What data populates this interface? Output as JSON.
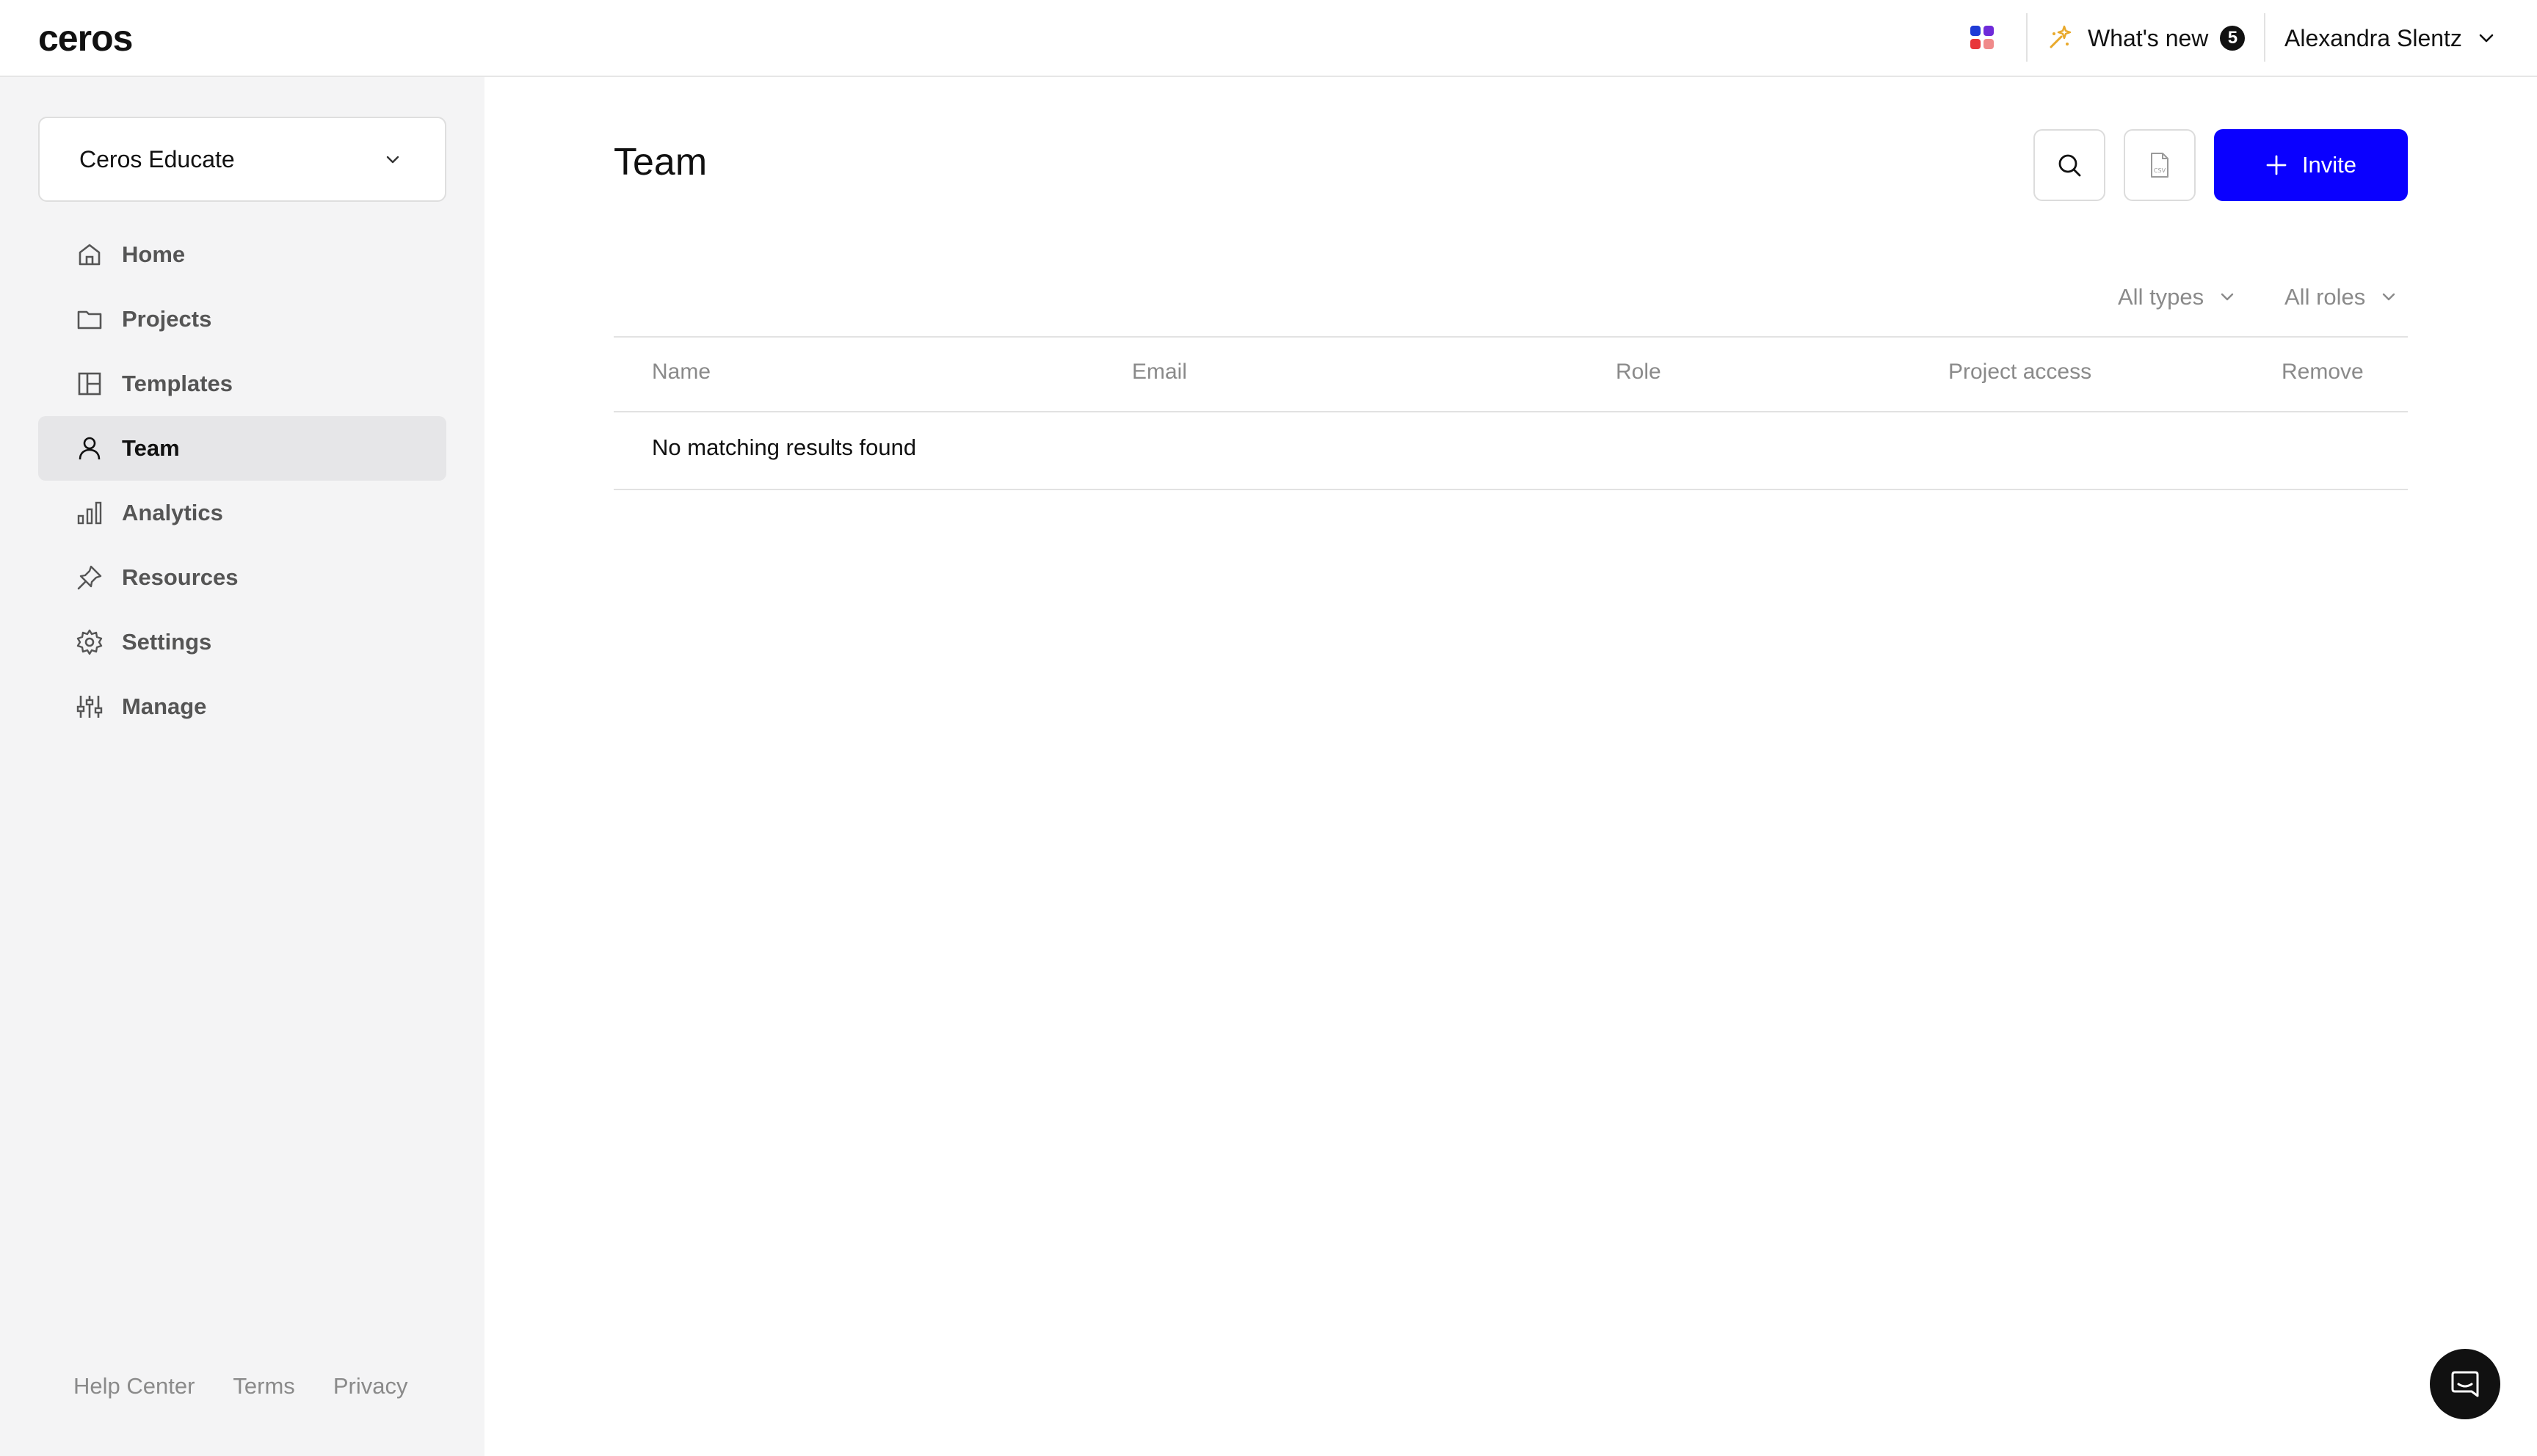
{
  "brand": {
    "logo_text": "ceros"
  },
  "topbar": {
    "apps_icon": "apps-grid-icon",
    "whats_new": {
      "label": "What's new",
      "count": "5",
      "icon": "sparkle-icon"
    },
    "user": {
      "name": "Alexandra Slentz",
      "icon": "chevron-down-icon"
    }
  },
  "sidebar": {
    "workspace": {
      "label": "Ceros Educate",
      "icon": "chevron-down-icon"
    },
    "items": [
      {
        "label": "Home",
        "icon": "home-icon",
        "active": false
      },
      {
        "label": "Projects",
        "icon": "folder-icon",
        "active": false
      },
      {
        "label": "Templates",
        "icon": "templates-icon",
        "active": false
      },
      {
        "label": "Team",
        "icon": "user-icon",
        "active": true
      },
      {
        "label": "Analytics",
        "icon": "bar-chart-icon",
        "active": false
      },
      {
        "label": "Resources",
        "icon": "pin-icon",
        "active": false
      },
      {
        "label": "Settings",
        "icon": "gear-icon",
        "active": false
      },
      {
        "label": "Manage",
        "icon": "sliders-icon",
        "active": false
      }
    ],
    "footer_links": [
      "Help Center",
      "Terms",
      "Privacy"
    ]
  },
  "main": {
    "title": "Team",
    "actions": {
      "search_icon": "search-icon",
      "csv_icon": "csv-file-icon",
      "csv_label": "CSV",
      "invite_label": "Invite"
    },
    "filters": {
      "types": "All types",
      "roles": "All roles"
    },
    "table": {
      "columns": [
        "Name",
        "Email",
        "Role",
        "Project access",
        "Remove"
      ],
      "empty_message": "No matching results found"
    }
  },
  "chat_launcher": {
    "icon": "chat-icon"
  },
  "colors": {
    "accent": "#0a00ff",
    "sidebar_bg": "#f4f4f5",
    "active_nav_bg": "#e6e6e8",
    "muted_text": "#8a8a8a"
  }
}
